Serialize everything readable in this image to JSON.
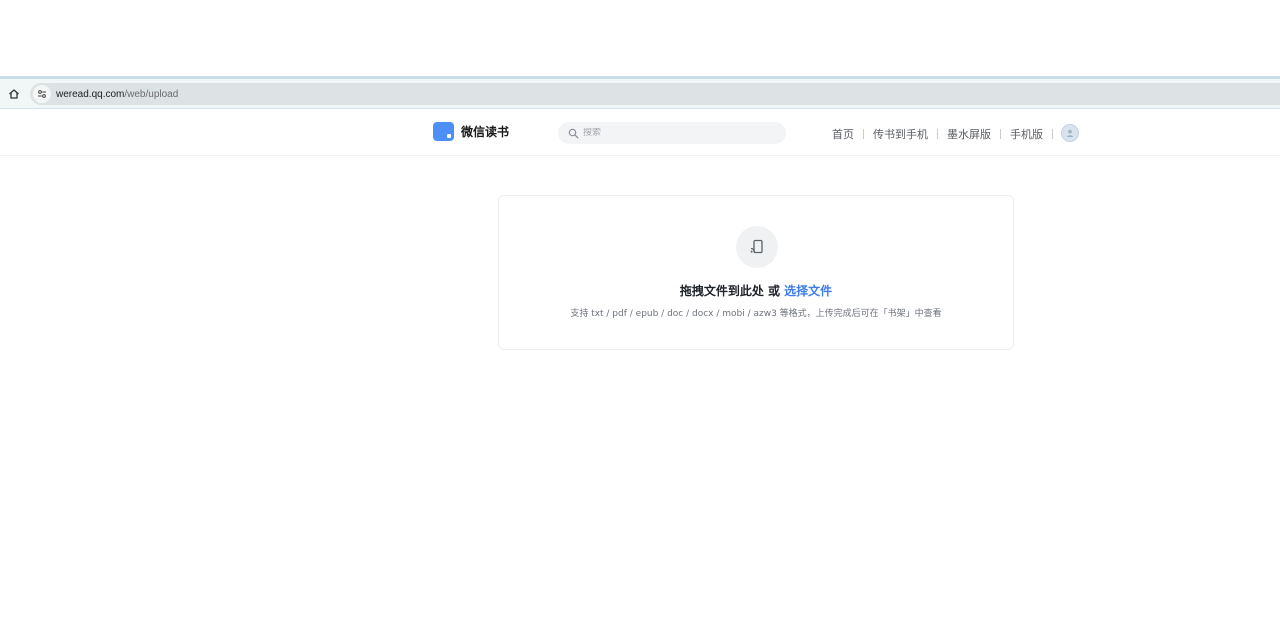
{
  "browser": {
    "url_host": "weread.qq.com",
    "url_path": "/web/upload"
  },
  "header": {
    "logo_text": "微信读书",
    "search_placeholder": "搜索",
    "nav": [
      "首页",
      "传书到手机",
      "墨水屏版",
      "手机版"
    ]
  },
  "upload": {
    "title_prefix": "拖拽文件到此处 或 ",
    "choose_link": "选择文件",
    "hint": "支持 txt / pdf / epub / doc / docx / mobi / azw3 等格式，上传完成后可在「书架」中查看"
  },
  "colors": {
    "accent": "#3f7ee8",
    "logo": "#4c8ff7"
  },
  "icons": {
    "home": "home-icon",
    "site_info": "site-info-icon",
    "search": "search-icon",
    "upload": "cast-device-icon",
    "avatar": "avatar-icon"
  }
}
